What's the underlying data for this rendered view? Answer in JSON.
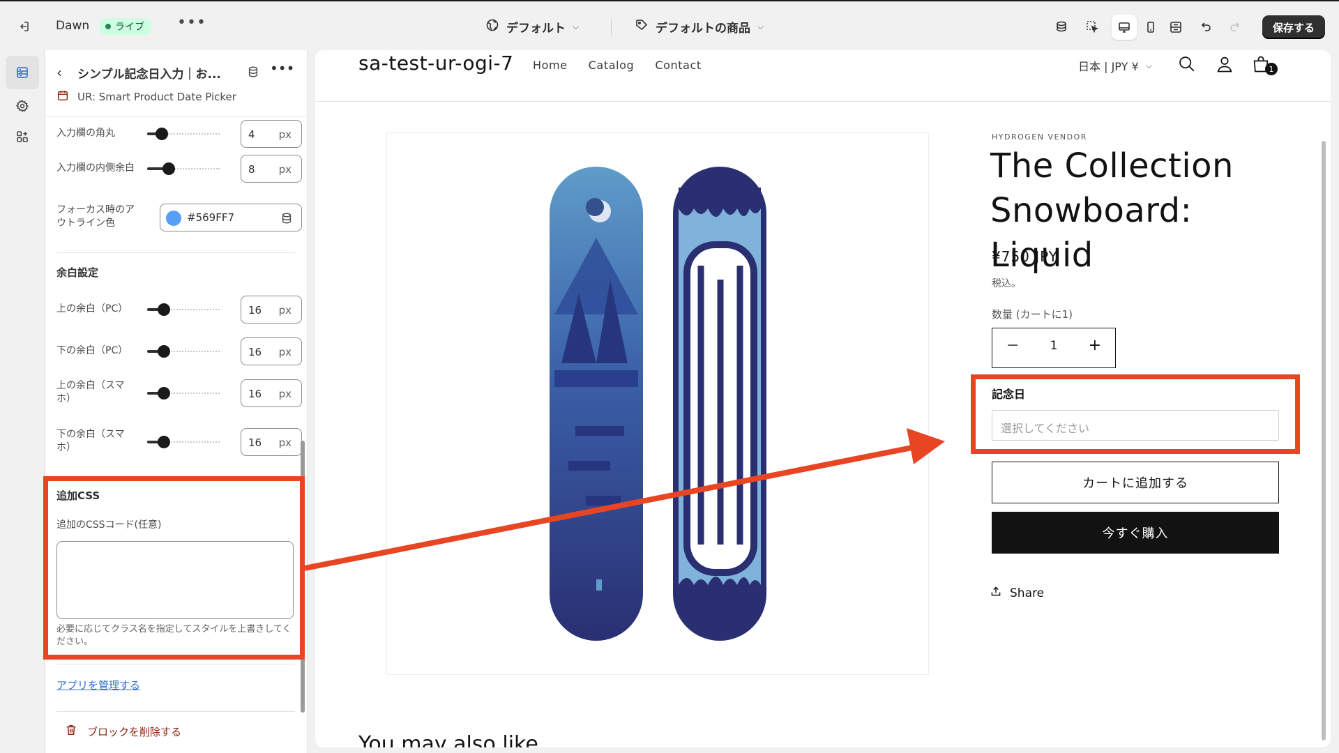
{
  "topbar": {
    "theme_name": "Dawn",
    "live_label": "ライブ",
    "more": "•••",
    "template_selector": "デフォルト",
    "product_selector": "デフォルトの商品",
    "save_label": "保存する"
  },
  "panel": {
    "title": "シンプル記念日入力｜お...",
    "app_name": "UR: Smart Product Date Picker",
    "settings": [
      {
        "label": "入力欄の角丸",
        "value": "4",
        "unit": "px",
        "fraction": 0.15
      },
      {
        "label": "入力欄の内側余白",
        "value": "8",
        "unit": "px",
        "fraction": 0.25
      }
    ],
    "focus_color": {
      "label": "フォーカス時のアウトライン色",
      "value": "#569FF7"
    },
    "spacing_section": "余白設定",
    "spacing": [
      {
        "label": "上の余白（PC）",
        "value": "16",
        "unit": "px",
        "fraction": 0.18
      },
      {
        "label": "下の余白（PC）",
        "value": "16",
        "unit": "px",
        "fraction": 0.18
      },
      {
        "label": "上の余白（スマホ）",
        "value": "16",
        "unit": "px",
        "fraction": 0.18
      },
      {
        "label": "下の余白（スマホ）",
        "value": "16",
        "unit": "px",
        "fraction": 0.18
      }
    ],
    "css_section": "追加CSS",
    "css_field_label": "追加のCSSコード(任意)",
    "css_value": "",
    "css_help": "必要に応じてクラス名を指定してスタイルを上書きしてください。",
    "manage_apps": "アプリを管理する",
    "delete_block": "ブロックを削除する"
  },
  "store": {
    "name": "sa-test-ur-ogi-7",
    "nav": [
      "Home",
      "Catalog",
      "Contact"
    ],
    "locale": "日本 | JPY ¥",
    "cart_count": "1"
  },
  "product": {
    "vendor": "HYDROGEN VENDOR",
    "title": "The Collection Snowboard: Liquid",
    "price": "¥750 JPY",
    "tax_note": "税込。",
    "qty_label": "数量 (カートに1)",
    "qty_value": "1",
    "date_label": "記念日",
    "date_placeholder": "選択してください",
    "add_to_cart": "カートに追加する",
    "buy_now": "今すぐ購入",
    "share": "Share",
    "also_like": "You may also like"
  },
  "colors": {
    "accent_annotation": "#e84522",
    "focus": "#569FF7",
    "brand_dark": "#303030"
  },
  "icons": [
    "exit-icon",
    "globe-icon",
    "tag-icon",
    "sections-icon",
    "gear-icon",
    "apps-icon",
    "database-icon",
    "calendar-icon",
    "search-icon",
    "account-icon",
    "cart-icon",
    "share-icon",
    "trash-icon",
    "undo-icon",
    "redo-icon",
    "desktop-view-icon",
    "mobile-view-icon",
    "fullwidth-view-icon"
  ]
}
